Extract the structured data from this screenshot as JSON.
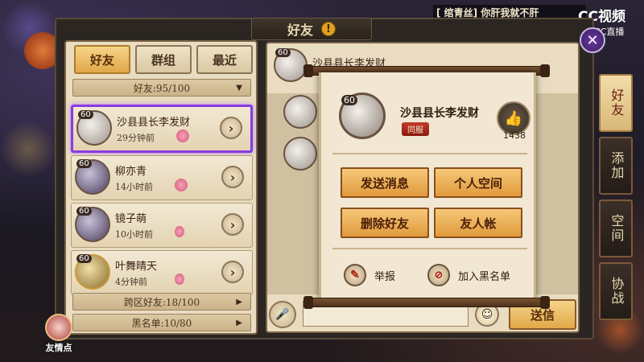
{
  "stream": {
    "caption": "[ 绾青丝] 你肝我就不肝",
    "logo_main": "CC视频",
    "logo_sub": "CC直播"
  },
  "window": {
    "title": "好友",
    "close_icon": "close-icon"
  },
  "left_panel": {
    "tabs": [
      {
        "label": "好友",
        "active": true
      },
      {
        "label": "群组",
        "active": false
      },
      {
        "label": "最近",
        "active": false
      }
    ],
    "friend_count": "好友:95/100",
    "friends": [
      {
        "level": "60",
        "name": "沙县县长李发财",
        "time": "29分钟前",
        "selected": true
      },
      {
        "level": "60",
        "name": "柳亦青",
        "time": "14小时前",
        "selected": false
      },
      {
        "level": "60",
        "name": "镜子萌",
        "time": "10小时前",
        "selected": false
      },
      {
        "level": "60",
        "name": "叶舞晴天",
        "time": "4分钟前",
        "selected": false
      }
    ],
    "cross_server": "跨区好友:18/100",
    "blacklist": "黑名单:10/80"
  },
  "friend_point": {
    "label": "友情点"
  },
  "chat": {
    "header_name": "沙县县长李发财",
    "header_level": "60",
    "send_label": "送信"
  },
  "side_nav": [
    {
      "label": "好友",
      "active": true
    },
    {
      "label": "添加",
      "active": false
    },
    {
      "label": "空间",
      "active": false
    },
    {
      "label": "协战",
      "active": false
    }
  ],
  "popup": {
    "level": "60",
    "name": "沙县县长李发财",
    "server_tag": "同服",
    "like_count": "1438",
    "actions": [
      "发送消息",
      "个人空间",
      "删除好友",
      "友人帐"
    ],
    "report_label": "举报",
    "blacklist_label": "加入黑名单"
  }
}
